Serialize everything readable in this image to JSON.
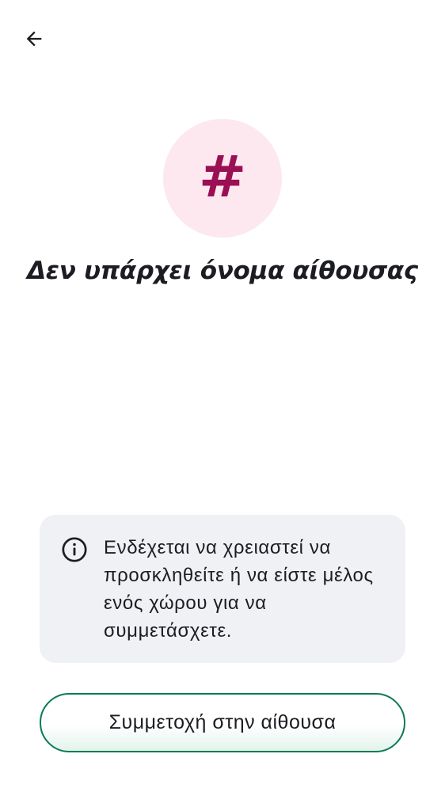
{
  "header": {
    "back_icon": "arrow-left-icon"
  },
  "avatar": {
    "glyph": "#",
    "background_color": "#fde8ef",
    "glyph_color": "#9b0f55"
  },
  "title": "Δεν υπάρχει όνομα αίθουσας",
  "info_card": {
    "icon": "info-circle-icon",
    "background_color": "#f0f1f5",
    "text": "Ενδέχεται να χρειαστεί να προσκληθείτε ή να είστε μέλος ενός χώρου για να συμμετάσχετε."
  },
  "join_button": {
    "label": "Συμμετοχή στην αίθουσα",
    "border_color": "#0b7a55"
  }
}
